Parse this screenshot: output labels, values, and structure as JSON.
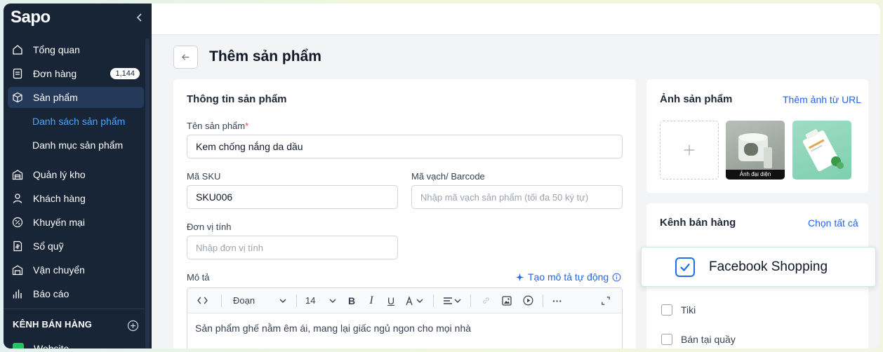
{
  "sidebar": {
    "logo": "Sapo",
    "items": [
      {
        "label": "Tổng quan",
        "icon": "home-icon"
      },
      {
        "label": "Đơn hàng",
        "icon": "order-icon",
        "badge": "1,144"
      },
      {
        "label": "Sản phẩm",
        "icon": "box-icon"
      },
      {
        "label": "Quản lý kho",
        "icon": "warehouse-icon"
      },
      {
        "label": "Khách hàng",
        "icon": "user-icon"
      },
      {
        "label": "Khuyến mại",
        "icon": "discount-icon"
      },
      {
        "label": "Sổ quỹ",
        "icon": "cashbook-icon"
      },
      {
        "label": "Vận chuyển",
        "icon": "truck-icon"
      },
      {
        "label": "Báo cáo",
        "icon": "report-icon"
      }
    ],
    "sub_items": [
      "Danh sách sản phẩm",
      "Danh mục sản phẩm"
    ],
    "section_title": "KÊNH BÁN HÀNG",
    "website_label": "Website"
  },
  "page": {
    "title": "Thêm sản phẩm"
  },
  "product_info": {
    "title": "Thông tin sản phẩm",
    "name_label": "Tên sản phẩm",
    "name_required": "*",
    "name_value": "Kem chống nắng da dầu",
    "sku_label": "Mã SKU",
    "sku_value": "SKU006",
    "barcode_label": "Mã vạch/ Barcode",
    "barcode_placeholder": "Nhập mã vạch sản phẩm (tối đa 50 ký tự)",
    "unit_label": "Đơn vị tính",
    "unit_placeholder": "Nhập đơn vị tính",
    "desc_label": "Mô tả",
    "ai_link": "Tạo mô tả tự động",
    "editor": {
      "paragraph": "Đoạn",
      "font_size": "14",
      "text": "Sản phẩm ghế nằm êm ái, mang lại giấc ngủ ngon cho mọi nhà"
    }
  },
  "images": {
    "title": "Ảnh sản phẩm",
    "url_link": "Thêm ảnh từ URL",
    "avatar_caption": "Ảnh đại diện"
  },
  "channels": {
    "title": "Kênh bán hàng",
    "select_all": "Chọn tất cả",
    "facebook": "Facebook Shopping",
    "tiki": "Tiki",
    "pos": "Bán tại quầy"
  },
  "colors": {
    "sidebar_bg": "#182537",
    "accent": "#2563eb",
    "active_sub": "#4da3ff"
  }
}
